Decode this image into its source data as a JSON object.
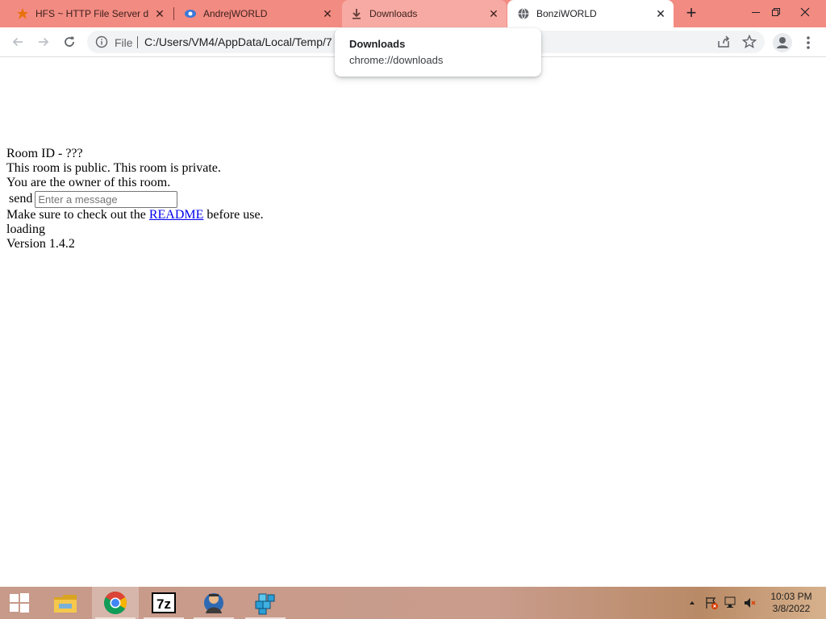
{
  "browser": {
    "tabs": [
      {
        "title": "HFS ~ HTTP File Server do",
        "favicon": "hfs-icon",
        "state": "inactive"
      },
      {
        "title": "AndrejWORLD",
        "favicon": "andrejworld-icon",
        "state": "inactive"
      },
      {
        "title": "Downloads",
        "favicon": "download-icon",
        "state": "hovered"
      },
      {
        "title": "BonziWORLD",
        "favicon": "globe-icon",
        "state": "active"
      }
    ],
    "new_tab_label": "+",
    "address": {
      "scheme_label": "File",
      "url": "C:/Users/VM4/AppData/Local/Temp/7"
    },
    "hovercard": {
      "title": "Downloads",
      "url": "chrome://downloads"
    },
    "colors": {
      "tabstrip": "#f28b82",
      "hovered_tab": "#f7aaa3",
      "active_tab": "#ffffff"
    }
  },
  "page": {
    "room_id": "Room ID - ???",
    "room_status": "This room is public. This room is private.",
    "owner_text": "You are the owner of this room.",
    "send_label": "send",
    "message_placeholder": "Enter a message",
    "message_value": "",
    "readme_prefix": "Make sure to check out the",
    "readme_link": "README",
    "readme_suffix": "before use.",
    "loading": "loading",
    "version": "Version 1.4.2"
  },
  "taskbar": {
    "apps": [
      {
        "name": "file-explorer-icon",
        "running": false
      },
      {
        "name": "chrome-icon",
        "running": true,
        "active": true
      },
      {
        "name": "7zip-icon",
        "running": true
      },
      {
        "name": "hfs-server-icon",
        "running": true
      },
      {
        "name": "registry-cubes-icon",
        "running": true
      }
    ],
    "clock": {
      "time": "10:03 PM",
      "date": "3/8/2022"
    }
  }
}
